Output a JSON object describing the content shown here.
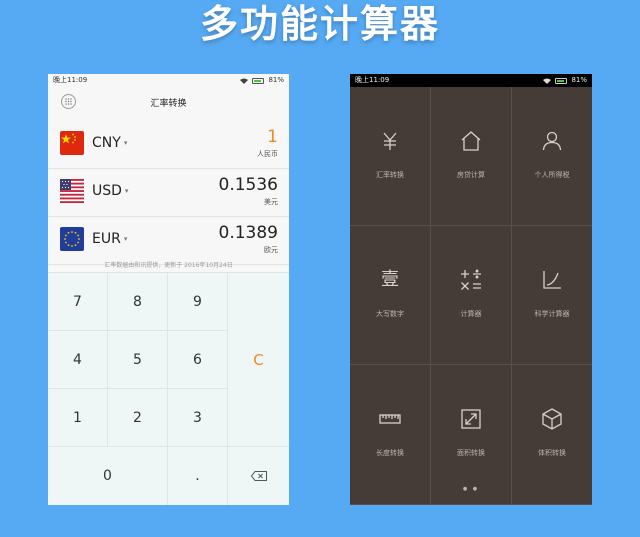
{
  "banner": {
    "title": "多功能计算器"
  },
  "converter": {
    "status": {
      "time": "晚上11:09",
      "battery": "81%"
    },
    "header": {
      "title": "汇率转换"
    },
    "currencies": [
      {
        "code": "CNY",
        "value": "1",
        "name": "人民币",
        "active": true,
        "flag": "cn-flag-icon"
      },
      {
        "code": "USD",
        "value": "0.1536",
        "name": "美元",
        "active": false,
        "flag": "us-flag-icon"
      },
      {
        "code": "EUR",
        "value": "0.1389",
        "name": "欧元",
        "active": false,
        "flag": "eu-flag-icon"
      }
    ],
    "caret": "▾",
    "note": "汇率数据由和讯提供，更新于 2016年10月24日",
    "keys": {
      "k7": "7",
      "k8": "8",
      "k9": "9",
      "clear": "C",
      "k4": "4",
      "k5": "5",
      "k6": "6",
      "k1": "1",
      "k2": "2",
      "k3": "3",
      "k0": "0",
      "dot": "."
    },
    "colors": {
      "accent": "#f0882a"
    }
  },
  "menu": {
    "status": {
      "time": "晚上11:09",
      "battery": "81%"
    },
    "tools": [
      {
        "label": "汇率转换",
        "icon": "yen-icon"
      },
      {
        "label": "房贷计算",
        "icon": "house-icon"
      },
      {
        "label": "个人所得税",
        "icon": "person-icon"
      },
      {
        "label": "大写数字",
        "icon": "chinese-numeral-icon",
        "glyph": "壹"
      },
      {
        "label": "计算器",
        "icon": "calculator-icon"
      },
      {
        "label": "科学计算器",
        "icon": "scientific-curve-icon"
      },
      {
        "label": "长度转换",
        "icon": "ruler-icon"
      },
      {
        "label": "面积转换",
        "icon": "area-resize-icon"
      },
      {
        "label": "体积转换",
        "icon": "cube-icon"
      }
    ],
    "pager": "● ●",
    "colors": {
      "background": "#463c37"
    }
  }
}
